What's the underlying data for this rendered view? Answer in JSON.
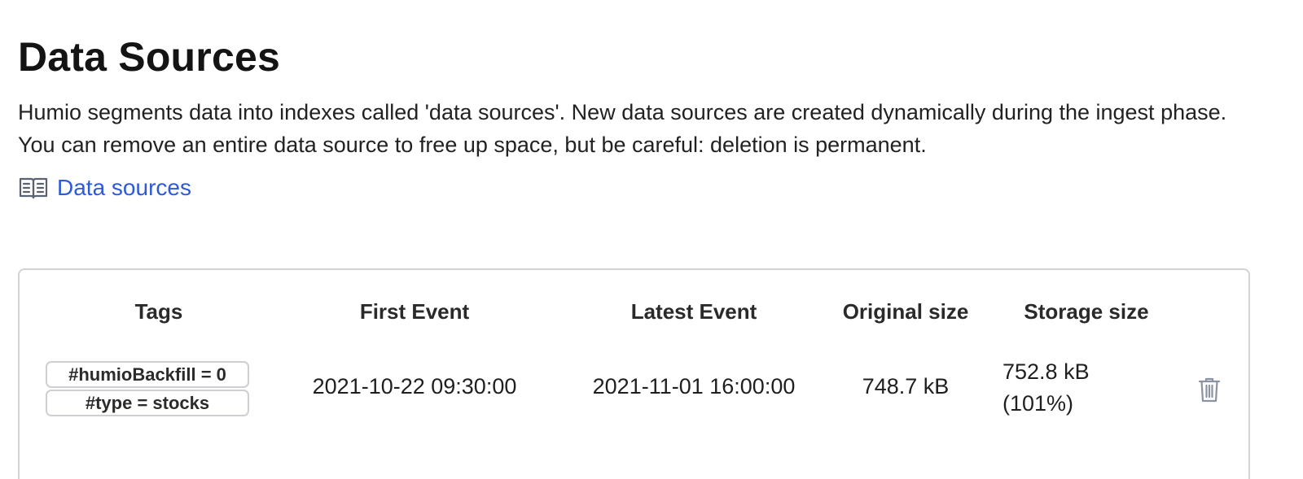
{
  "page": {
    "title": "Data Sources",
    "description": "Humio segments data into indexes called 'data sources'. New data sources are created dynamically during the ingest phase. You can remove an entire data source to free up space, but be careful: deletion is permanent.",
    "doc_link": {
      "label": "Data sources",
      "icon": "book-icon",
      "color": "#2d5bd7"
    }
  },
  "table": {
    "columns": [
      "Tags",
      "First Event",
      "Latest Event",
      "Original size",
      "Storage size"
    ],
    "rows": [
      {
        "tags": [
          "#humioBackfill = 0",
          "#type = stocks"
        ],
        "first_event": "2021-10-22 09:30:00",
        "latest_event": "2021-11-01 16:00:00",
        "original_size": "748.7 kB",
        "storage_size": "752.8 kB",
        "storage_percent": "(101%)",
        "delete_icon": "trash-icon"
      }
    ]
  }
}
